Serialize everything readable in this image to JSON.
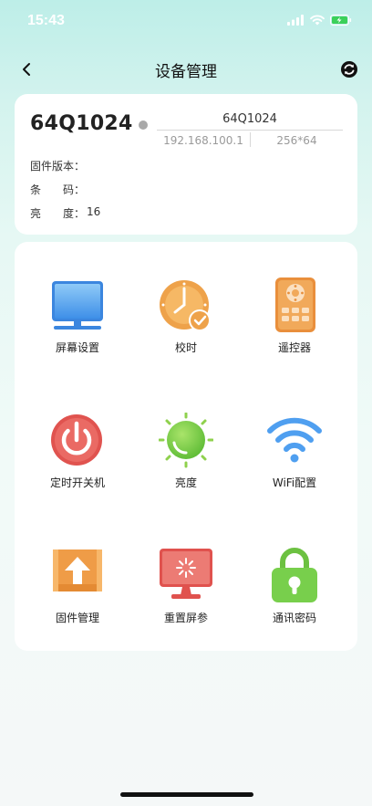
{
  "status": {
    "time": "15:43"
  },
  "navbar": {
    "title": "设备管理"
  },
  "device": {
    "name": "64Q1024",
    "id": "64Q1024",
    "ip": "192.168.100.1",
    "resolution": "256*64",
    "firmware_label": "固件版本：",
    "firmware_value": "",
    "barcode_label": "条　　码：",
    "barcode_value": "",
    "brightness_label": "亮　　度：",
    "brightness_value": "16",
    "status_color": "#a9a9a9"
  },
  "grid": {
    "screen_settings": "屏幕设置",
    "time_sync": "校时",
    "remote": "遥控器",
    "power_schedule": "定时开关机",
    "brightness": "亮度",
    "wifi_config": "WiFi配置",
    "firmware": "固件管理",
    "reset_params": "重置屏参",
    "comm_password": "通讯密码"
  },
  "icons": {
    "back": "chevron-left-icon",
    "refresh": "refresh-icon",
    "screen": "monitor-icon",
    "clock": "clock-check-icon",
    "remote": "remote-icon",
    "power": "power-icon",
    "sun": "sun-icon",
    "wifi": "wifi-icon",
    "upload": "upload-icon",
    "reset": "reset-screen-icon",
    "lock": "lock-icon"
  },
  "colors": {
    "orange": "#f0a64a",
    "blue": "#4d9ff0",
    "red": "#e2514e",
    "green": "#78cf4c"
  }
}
